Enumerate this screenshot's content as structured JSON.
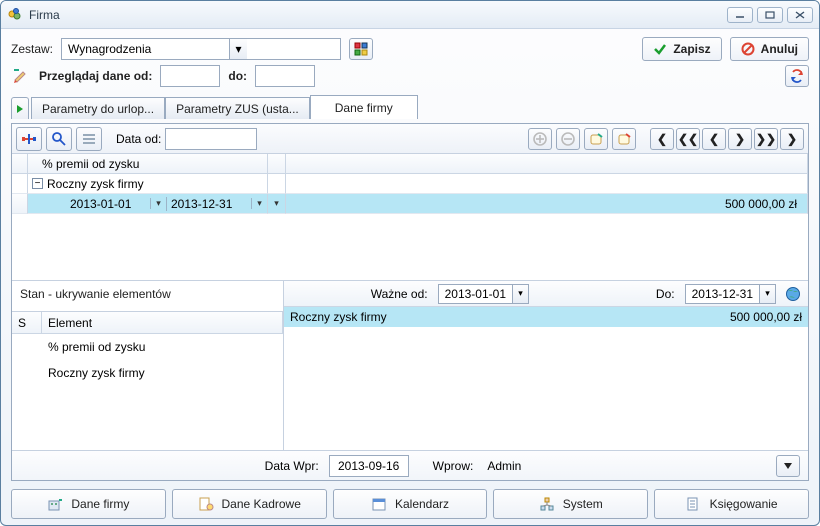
{
  "window": {
    "title": "Firma"
  },
  "row1": {
    "zestaw_label": "Zestaw:",
    "zestaw_value": "Wynagrodzenia",
    "save_label": "Zapisz",
    "cancel_label": "Anuluj"
  },
  "row2": {
    "browse_label": "Przeglądaj dane od:",
    "to_label": "do:",
    "from_value": "",
    "to_value": ""
  },
  "tabs": {
    "t1": "Parametry do urlop...",
    "t2": "Parametry ZUS (usta...",
    "t3": "Dane firmy"
  },
  "toolbar": {
    "data_od_label": "Data od:",
    "data_od_value": ""
  },
  "grid": {
    "row1_label": "% premii od zysku",
    "row2_label": "Roczny zysk firmy",
    "date_from": "2013-01-01",
    "date_to": "2013-12-31",
    "amount": "500 000,00 zł"
  },
  "left_panel": {
    "title": "Stan - ukrywanie elementów",
    "col_s": "S",
    "col_el": "Element",
    "item1": "% premii od zysku",
    "item2": "Roczny zysk firmy"
  },
  "right_panel": {
    "wazne_od": "Ważne od:",
    "wazne_od_val": "2013-01-01",
    "do": "Do:",
    "do_val": "2013-12-31",
    "row_label": "Roczny zysk firmy",
    "row_amount": "500 000,00 zł"
  },
  "footer": {
    "data_wpr": "Data Wpr:",
    "data_wpr_val": "2013-09-16",
    "wprow": "Wprow:",
    "wprow_val": "Admin"
  },
  "bottom": {
    "b1": "Dane firmy",
    "b2": "Dane Kadrowe",
    "b3": "Kalendarz",
    "b4": "System",
    "b5": "Księgowanie"
  }
}
